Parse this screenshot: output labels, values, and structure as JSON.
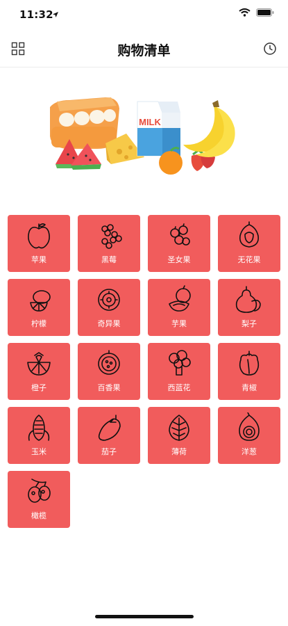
{
  "status_bar": {
    "time": "11:32",
    "icons": [
      "location-arrow-icon",
      "wifi-icon",
      "battery-icon"
    ]
  },
  "nav": {
    "title": "购物清单",
    "left_icon": "grid-icon",
    "right_icon": "clock-icon"
  },
  "hero": {
    "milk_text": "MILK"
  },
  "colors": {
    "tile": "#f15c5c",
    "tile_text": "#ffffff"
  },
  "items": [
    {
      "label": "苹果",
      "icon": "apple-icon"
    },
    {
      "label": "黑莓",
      "icon": "blackberry-icon"
    },
    {
      "label": "圣女果",
      "icon": "cherry-tomato-icon"
    },
    {
      "label": "无花果",
      "icon": "fig-icon"
    },
    {
      "label": "柠檬",
      "icon": "lemon-icon"
    },
    {
      "label": "奇异果",
      "icon": "kiwi-icon"
    },
    {
      "label": "芋果",
      "icon": "melon-icon"
    },
    {
      "label": "梨子",
      "icon": "pear-icon"
    },
    {
      "label": "橙子",
      "icon": "orange-icon"
    },
    {
      "label": "百香果",
      "icon": "passion-fruit-icon"
    },
    {
      "label": "西蓝花",
      "icon": "broccoli-icon"
    },
    {
      "label": "青椒",
      "icon": "pepper-icon"
    },
    {
      "label": "玉米",
      "icon": "corn-icon"
    },
    {
      "label": "茄子",
      "icon": "eggplant-icon"
    },
    {
      "label": "薄荷",
      "icon": "mint-leaf-icon"
    },
    {
      "label": "洋葱",
      "icon": "onion-icon"
    },
    {
      "label": "橄榄",
      "icon": "olive-icon"
    }
  ]
}
